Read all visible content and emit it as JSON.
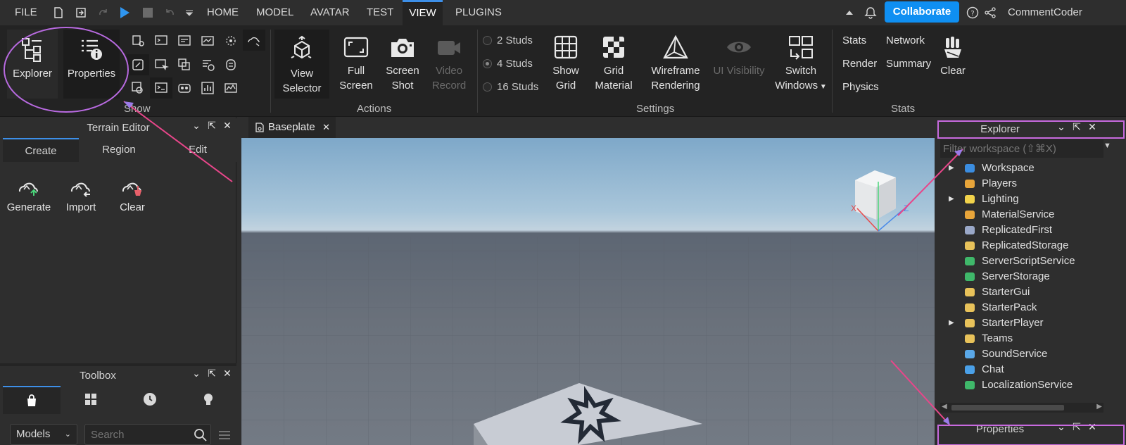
{
  "menubar": {
    "file": "FILE",
    "tabs": [
      "HOME",
      "MODEL",
      "AVATAR",
      "TEST",
      "VIEW",
      "PLUGINS"
    ],
    "collaborate": "Collaborate",
    "username": "CommentCoder"
  },
  "ribbon": {
    "show": {
      "explorer": "Explorer",
      "properties": "Properties",
      "group": "Show"
    },
    "actions": {
      "view_selector": [
        "View",
        "Selector"
      ],
      "full_screen": [
        "Full",
        "Screen"
      ],
      "screen_shot": [
        "Screen",
        "Shot"
      ],
      "video_record": [
        "Video",
        "Record"
      ],
      "group": "Actions"
    },
    "settings": {
      "studs": [
        "2 Studs",
        "4 Studs",
        "16 Studs"
      ],
      "selected_stud": 1,
      "show_grid": [
        "Show",
        "Grid"
      ],
      "grid_material": [
        "Grid",
        "Material"
      ],
      "wireframe": [
        "Wireframe",
        "Rendering"
      ],
      "ui_visibility": "UI Visibility",
      "switch_windows": [
        "Switch",
        "Windows"
      ],
      "group": "Settings"
    },
    "stats": {
      "stats": "Stats",
      "network": "Network",
      "render": "Render",
      "summary": "Summary",
      "physics": "Physics",
      "clear": "Clear",
      "group": "Stats"
    }
  },
  "terrain": {
    "title": "Terrain Editor",
    "tabs": [
      "Create",
      "Region",
      "Edit"
    ],
    "active_tab": 0,
    "tools": [
      "Generate",
      "Import",
      "Clear"
    ]
  },
  "toolbox": {
    "title": "Toolbox",
    "category": "Models",
    "search_placeholder": "Search"
  },
  "viewport": {
    "tab": "Baseplate",
    "axis_x": "X",
    "axis_z": "Z"
  },
  "explorer": {
    "title": "Explorer",
    "filter_placeholder": "Filter workspace (⇧⌘X)",
    "items": [
      {
        "label": "Workspace",
        "expandable": true,
        "color": "#3b8de0"
      },
      {
        "label": "Players",
        "expandable": false,
        "color": "#e8a53a"
      },
      {
        "label": "Lighting",
        "expandable": true,
        "color": "#f2d34b"
      },
      {
        "label": "MaterialService",
        "expandable": false,
        "color": "#e8a53a"
      },
      {
        "label": "ReplicatedFirst",
        "expandable": false,
        "color": "#9aa8c8"
      },
      {
        "label": "ReplicatedStorage",
        "expandable": false,
        "color": "#e8c25a"
      },
      {
        "label": "ServerScriptService",
        "expandable": false,
        "color": "#3fb86a"
      },
      {
        "label": "ServerStorage",
        "expandable": false,
        "color": "#3fb86a"
      },
      {
        "label": "StarterGui",
        "expandable": false,
        "color": "#e8c25a"
      },
      {
        "label": "StarterPack",
        "expandable": false,
        "color": "#e8c25a"
      },
      {
        "label": "StarterPlayer",
        "expandable": true,
        "color": "#e8c25a"
      },
      {
        "label": "Teams",
        "expandable": false,
        "color": "#e8c25a"
      },
      {
        "label": "SoundService",
        "expandable": false,
        "color": "#5aa8e8"
      },
      {
        "label": "Chat",
        "expandable": false,
        "color": "#4aa0e8"
      },
      {
        "label": "LocalizationService",
        "expandable": false,
        "color": "#3fb86a"
      }
    ]
  },
  "properties": {
    "title": "Properties"
  },
  "colors": {
    "accent": "#3d8fe8",
    "collaborate": "#0f8ff2",
    "annotation_pink": "#e8468a",
    "annotation_purple": "#9b7be8"
  }
}
